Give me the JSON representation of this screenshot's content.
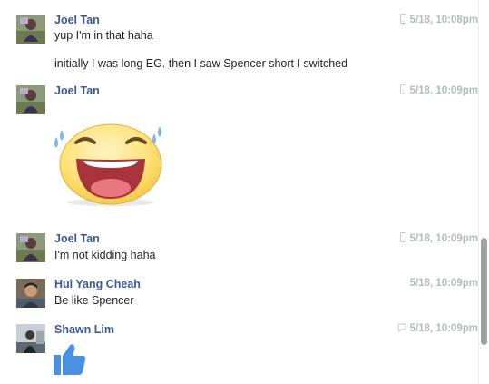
{
  "messages": [
    {
      "sender": "Joel Tan",
      "avatar_icon": "profile-photo-joel-tan",
      "source_icon": "mobile-phone-icon",
      "time": "5/18, 10:08pm",
      "lines": [
        "yup I'm in that haha",
        "initially I was long EG. then I saw Spencer short I switched"
      ]
    },
    {
      "sender": "Joel Tan",
      "avatar_icon": "profile-photo-joel-tan",
      "source_icon": "mobile-phone-icon",
      "time": "5/18, 10:09pm",
      "sticker": "laughing-tears-sticker"
    },
    {
      "sender": "Joel Tan",
      "avatar_icon": "profile-photo-joel-tan",
      "source_icon": "mobile-phone-icon",
      "time": "5/18, 10:09pm",
      "lines": [
        "I'm not kidding haha"
      ]
    },
    {
      "sender": "Hui Yang Cheah",
      "avatar_icon": "profile-photo-hui-yang-cheah",
      "time": "5/18, 10:09pm",
      "lines": [
        "Be like Spencer"
      ]
    },
    {
      "sender": "Shawn Lim",
      "avatar_icon": "profile-photo-shawn-lim",
      "source_icon": "chat-bubble-icon",
      "time": "5/18, 10:09pm",
      "sticker": "thumbs-up-like-icon"
    }
  ],
  "colors": {
    "sender_name": "#3b5998",
    "timestamp": "#b4bac4",
    "like_blue": "#4a90e2",
    "scrollbar": "#9fa3a8"
  }
}
